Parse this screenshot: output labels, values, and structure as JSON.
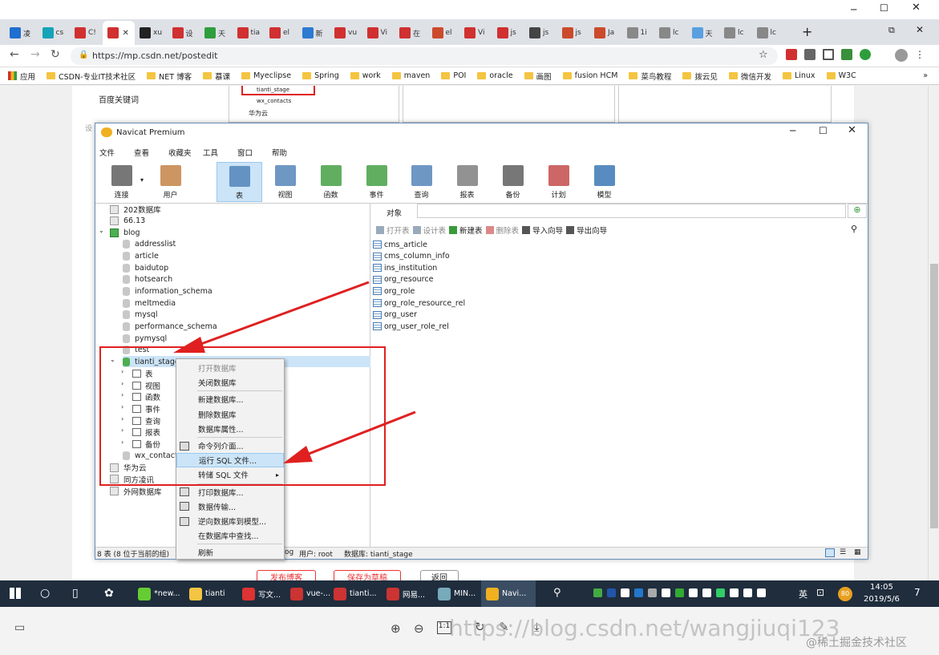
{
  "browser": {
    "tabs": [
      {
        "label": "凌",
        "color": "#1e6fd0"
      },
      {
        "label": "cs",
        "color": "#15a3b7"
      },
      {
        "label": "C!",
        "color": "#d03030"
      },
      {
        "label": "",
        "color": "#d03030",
        "active": true
      },
      {
        "label": "xu",
        "color": "#222"
      },
      {
        "label": "设",
        "color": "#d03030"
      },
      {
        "label": "天",
        "color": "#2e9e3d"
      },
      {
        "label": "tia",
        "color": "#d03030"
      },
      {
        "label": "el",
        "color": "#d03030"
      },
      {
        "label": "新",
        "color": "#2b7bd1"
      },
      {
        "label": "vu",
        "color": "#d03030"
      },
      {
        "label": "Vi",
        "color": "#d03030"
      },
      {
        "label": "在",
        "color": "#d03030"
      },
      {
        "label": "el",
        "color": "#cc4a2b"
      },
      {
        "label": "Vi",
        "color": "#d03030"
      },
      {
        "label": "js",
        "color": "#d03030"
      },
      {
        "label": "js",
        "color": "#444"
      },
      {
        "label": "js",
        "color": "#cc4a2b"
      },
      {
        "label": "Ja",
        "color": "#cc4a2b"
      },
      {
        "label": "1i",
        "color": "#888"
      },
      {
        "label": "lc",
        "color": "#888"
      },
      {
        "label": "天",
        "color": "#5aa0e0"
      },
      {
        "label": "lc",
        "color": "#888"
      },
      {
        "label": "lc",
        "color": "#888"
      }
    ],
    "url": "https://mp.csdn.net/postedit",
    "bookmarks": [
      "应用",
      "CSDN-专业IT技术社区",
      "NET 博客",
      "慕课",
      "Myeclipse",
      "Spring",
      "work",
      "maven",
      "POI",
      "oracle",
      "画图",
      "fusion HCM",
      "菜鸟教程",
      "拨云见",
      "微信开发",
      "Linux",
      "W3C"
    ]
  },
  "page": {
    "left_label": "百度关键词",
    "left_label2": "设",
    "bg_tree": [
      "tianti_stage",
      "wx_contacts",
      "华为云",
      "同方凌讯"
    ],
    "buttons": [
      "发布博客",
      "保存为草稿",
      "返回"
    ]
  },
  "navicat": {
    "title": "Navicat Premium",
    "menu": [
      "文件",
      "查看",
      "收藏夹",
      "工具",
      "窗口",
      "帮助"
    ],
    "toolbar": [
      {
        "label": "连接",
        "color": "#555"
      },
      {
        "label": "用户",
        "color": "#c07a3a"
      },
      {
        "label": "表",
        "color": "#4a7db5"
      },
      {
        "label": "视图",
        "color": "#4a7db5"
      },
      {
        "label": "函数",
        "color": "#3a9a3a"
      },
      {
        "label": "事件",
        "color": "#3a9a3a"
      },
      {
        "label": "查询",
        "color": "#4a7db5"
      },
      {
        "label": "报表",
        "color": "#777"
      },
      {
        "label": "备份",
        "color": "#555"
      },
      {
        "label": "计划",
        "color": "#c04040"
      },
      {
        "label": "模型",
        "color": "#2e6fb0"
      }
    ],
    "tree": {
      "connections_top": [
        "202数据库",
        "66.13"
      ],
      "blog": "blog",
      "databases": [
        "addresslist",
        "article",
        "baidutop",
        "hotsearch",
        "information_schema",
        "meltmedia",
        "mysql",
        "performance_schema",
        "pymysql",
        "test"
      ],
      "selected_db": "tianti_stage",
      "objects": [
        "表",
        "视图",
        "函数",
        "事件",
        "查询",
        "报表",
        "备份"
      ],
      "wx": "wx_contact",
      "connections_bottom": [
        "华为云",
        "同方凌讯",
        "外网数据库"
      ]
    },
    "object_tab": "对象",
    "obj_toolbar": [
      "打开表",
      "设计表",
      "新建表",
      "删除表",
      "导入向导",
      "导出向导"
    ],
    "tables": [
      "cms_article",
      "cms_column_info",
      "ins_institution",
      "org_resource",
      "org_role",
      "org_role_resource_rel",
      "org_user",
      "org_user_role_rel"
    ],
    "context_menu": {
      "group1": [
        {
          "label": "打开数据库",
          "disabled": true
        },
        {
          "label": "关闭数据库"
        }
      ],
      "group2": [
        "新建数据库...",
        "删除数据库",
        "数据库属性..."
      ],
      "group3": [
        "命令列介面...",
        "运行 SQL 文件...",
        "转储 SQL 文件"
      ],
      "group4": [
        "打印数据库...",
        "数据传输...",
        "逆向数据库到模型...",
        "在数据库中查找..."
      ],
      "group5": [
        "刷新"
      ]
    },
    "status": {
      "left": "8 表 (8 位于当前的组)",
      "blog": "og",
      "user": "用户: root",
      "db": "数据库: tianti_stage"
    }
  },
  "taskbar": {
    "apps": [
      "*new...",
      "tianti",
      "写文...",
      "",
      "vue-...",
      "tianti...",
      "网易...",
      "MIN...",
      "Navi..."
    ],
    "lang": "英",
    "badge": "80",
    "time": "14:05",
    "date": "2019/5/6",
    "notif": "7"
  },
  "watermark": "https://blog.csdn.net/wangjiuqi123",
  "credit": "@稀土掘金技术社区"
}
